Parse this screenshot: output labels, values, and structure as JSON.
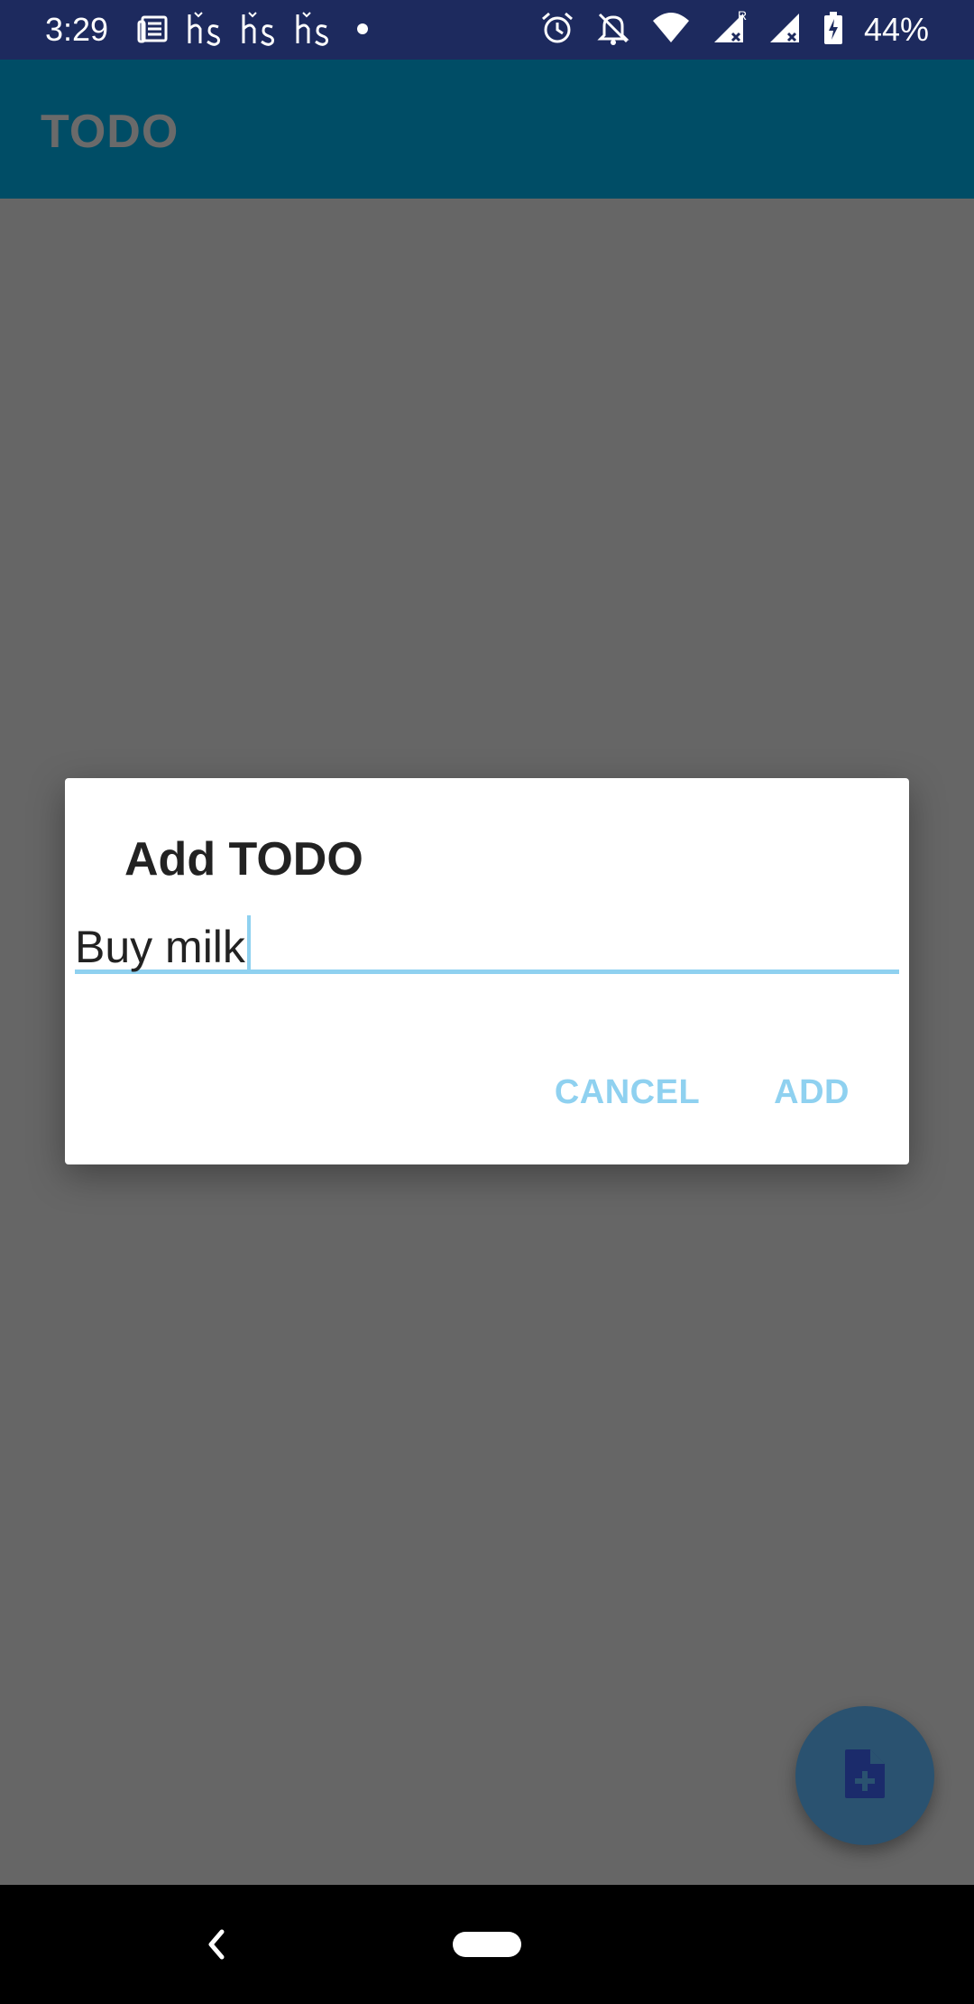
{
  "status_bar": {
    "time": "3:29",
    "battery_text": "44%",
    "left_icons": [
      "newspaper-icon",
      "hs-app-icon",
      "hs-app-icon",
      "hs-app-icon",
      "dot-icon"
    ],
    "right_icons": [
      "alarm-icon",
      "notifications-off-icon",
      "wifi-icon",
      "signal-roaming-icon",
      "signal-icon",
      "battery-charging-icon"
    ]
  },
  "app_bar": {
    "title": "TODO"
  },
  "dialog": {
    "title": "Add TODO",
    "input_value": "Buy milk",
    "cancel_label": "CANCEL",
    "add_label": "ADD"
  },
  "fab": {
    "icon": "add-note-icon"
  },
  "nav": {
    "back_icon": "back-icon",
    "home_icon": "home-pill-icon"
  },
  "colors": {
    "status_bar": "#1d2a5e",
    "app_bar": "#004d66",
    "scrim": "#666666",
    "accent": "#8fd1f0",
    "fab": "#2a5270",
    "fab_icon": "#1b2b6b"
  }
}
